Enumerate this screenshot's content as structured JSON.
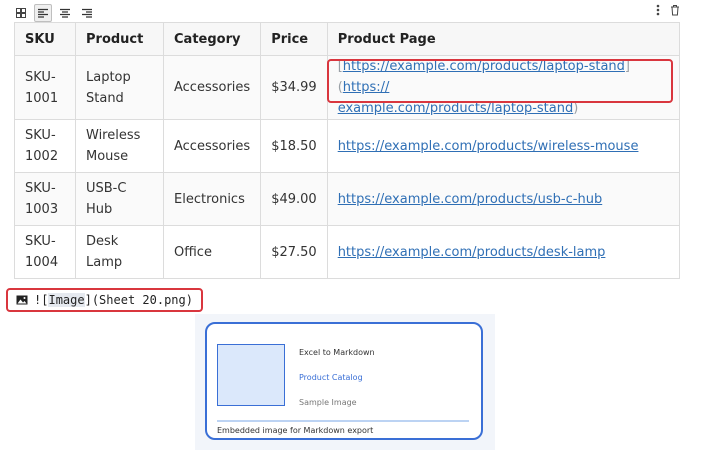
{
  "toolbar": {
    "buttons": [
      {
        "icon": "table-grid-icon",
        "active": false
      },
      {
        "icon": "align-left-icon",
        "active": true
      },
      {
        "icon": "align-center-icon",
        "active": false
      },
      {
        "icon": "align-right-icon",
        "active": false
      }
    ],
    "right_icons": [
      "more-vertical-icon",
      "trash-icon"
    ]
  },
  "table": {
    "headers": [
      "SKU",
      "Product",
      "Category",
      "Price",
      "Product Page"
    ],
    "rows": [
      {
        "sku": "SKU-\n1001",
        "product": "Laptop\nStand",
        "category": "Accessories",
        "price": "$34.99",
        "page_raw": {
          "open": "[",
          "text": "https://example.com/products/laptop-stand",
          "mid": "](",
          "url": "https://\nexample.com/products/laptop-stand",
          "close": ")"
        }
      },
      {
        "sku": "SKU-\n1002",
        "product": "Wireless\nMouse",
        "category": "Accessories",
        "price": "$18.50",
        "page": "https://example.com/products/wireless-mouse"
      },
      {
        "sku": "SKU-\n1003",
        "product": "USB-C\nHub",
        "category": "Electronics",
        "price": "$49.00",
        "page": "https://example.com/products/usb-c-hub"
      },
      {
        "sku": "SKU-\n1004",
        "product": "Desk\nLamp",
        "category": "Office",
        "price": "$27.50",
        "page": "https://example.com/products/desk-lamp"
      }
    ]
  },
  "markdown_image": {
    "icon": "image-icon",
    "prefix": "!",
    "open": "[",
    "word": "Image",
    "close": "](Sheet 20.png)"
  },
  "preview": {
    "title": "Excel to Markdown",
    "link": "Product Catalog",
    "sample": "Sample Image",
    "caption": "Embedded image for Markdown export"
  },
  "colors": {
    "link": "#2f6fb5",
    "highlight": "#d9363e",
    "preview_blue": "#3a6fd6"
  }
}
